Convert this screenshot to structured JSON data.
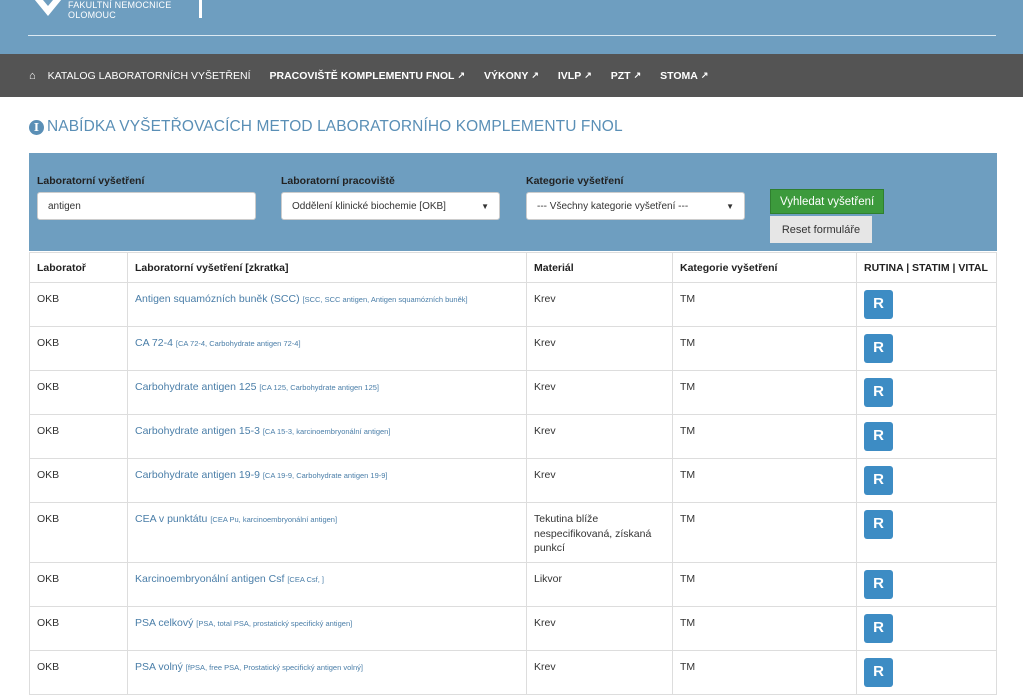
{
  "header": {
    "logo_line1": "FAKULTNÍ NEMOCNICE",
    "logo_line2": "OLOMOUC"
  },
  "nav": {
    "home_icon": "home-icon",
    "items": [
      {
        "label": "Katalog laboratorních vyšetření",
        "bold": false,
        "external": false
      },
      {
        "label": "Pracoviště komplementu FNOL",
        "bold": true,
        "external": true
      },
      {
        "label": "Výkony",
        "bold": true,
        "external": true
      },
      {
        "label": "IVLP",
        "bold": true,
        "external": true
      },
      {
        "label": "PZT",
        "bold": true,
        "external": true
      },
      {
        "label": "STOMA",
        "bold": true,
        "external": true
      }
    ]
  },
  "title": "Nabídka vyšetřovacích metod laboratorního komplementu FNOL",
  "filter": {
    "exam_label": "Laboratorní vyšetření",
    "exam_value": "antigen",
    "workplace_label": "Laboratorní pracoviště",
    "workplace_value": "Oddělení klinické biochemie [OKB]",
    "category_label": "Kategorie vyšetření",
    "category_value": "--- Všechny kategorie vyšetření ---",
    "search_button": "Vyhledat vyšetření",
    "reset_button": "Reset formuláře"
  },
  "table": {
    "headers": [
      "Laboratoř",
      "Laboratorní vyšetření [zkratka]",
      "Materiál",
      "Kategorie vyšetření",
      "RUTINA | STATIM | VITAL"
    ],
    "rows": [
      {
        "lab": "OKB",
        "name": "Antigen squamózních buněk (SCC)",
        "abbr": "[SCC, SCC antigen, Antigen squamózních buněk]",
        "material": "Krev",
        "category": "TM",
        "badge": "R"
      },
      {
        "lab": "OKB",
        "name": "CA 72-4",
        "abbr": "[CA 72-4, Carbohydrate antigen 72-4]",
        "material": "Krev",
        "category": "TM",
        "badge": "R"
      },
      {
        "lab": "OKB",
        "name": "Carbohydrate antigen 125",
        "abbr": "[CA 125, Carbohydrate antigen 125]",
        "material": "Krev",
        "category": "TM",
        "badge": "R"
      },
      {
        "lab": "OKB",
        "name": "Carbohydrate antigen 15-3",
        "abbr": "[CA 15-3, karcinoembryonální antigen]",
        "material": "Krev",
        "category": "TM",
        "badge": "R"
      },
      {
        "lab": "OKB",
        "name": "Carbohydrate antigen 19-9",
        "abbr": "[CA 19-9, Carbohydrate antigen 19-9]",
        "material": "Krev",
        "category": "TM",
        "badge": "R"
      },
      {
        "lab": "OKB",
        "name": "CEA v punktátu",
        "abbr": "[CEA Pu, karcinoembryonální antigen]",
        "material": "Tekutina blíže nespecifikovaná, získaná punkcí",
        "category": "TM",
        "badge": "R"
      },
      {
        "lab": "OKB",
        "name": "Karcinoembryonální antigen Csf",
        "abbr": "[CEA Csf, ]",
        "material": "Likvor",
        "category": "TM",
        "badge": "R"
      },
      {
        "lab": "OKB",
        "name": "PSA celkový",
        "abbr": "[PSA, total PSA, prostatický specifický antigen]",
        "material": "Krev",
        "category": "TM",
        "badge": "R"
      },
      {
        "lab": "OKB",
        "name": "PSA volný",
        "abbr": "[fPSA, free PSA, Prostatický specifický antigen volný]",
        "material": "Krev",
        "category": "TM",
        "badge": "R"
      }
    ]
  }
}
